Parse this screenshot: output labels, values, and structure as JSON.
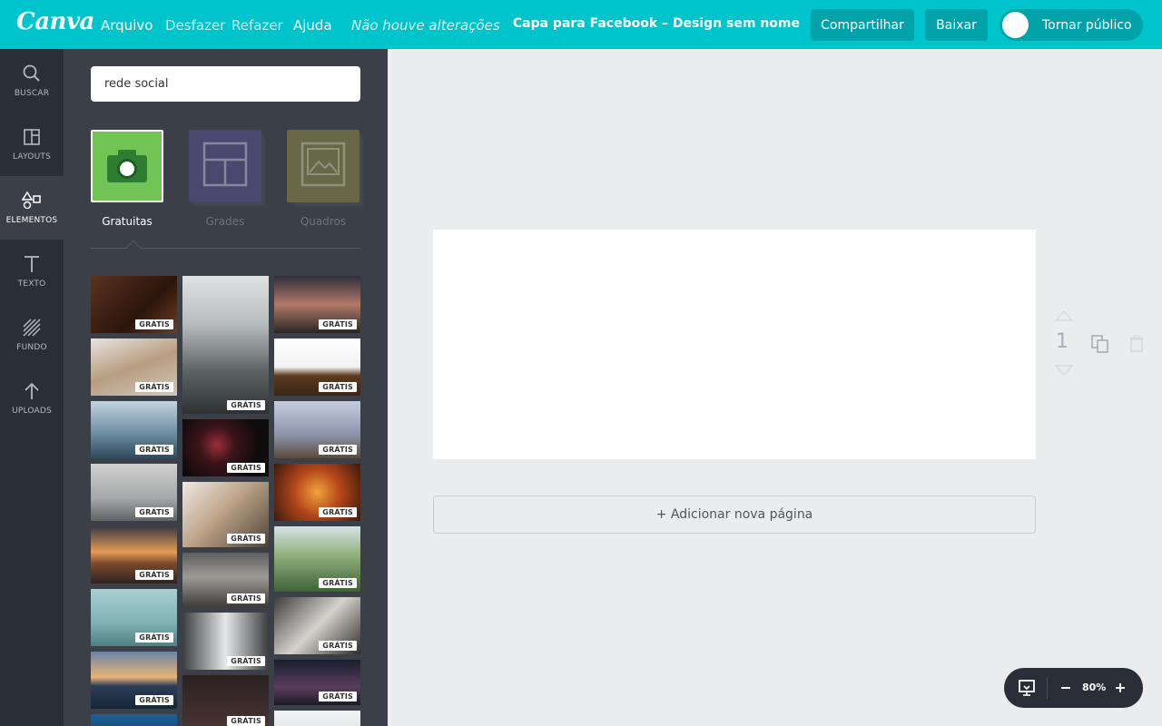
{
  "app": {
    "logo": "Canva"
  },
  "menu": {
    "file": "Arquivo",
    "undo": "Desfazer",
    "redo": "Refazer",
    "help": "Ajuda",
    "status": "Não houve alterações"
  },
  "header": {
    "doc_title": "Capa para Facebook – Design sem nome",
    "share": "Compartilhar",
    "download": "Baixar",
    "make_public": "Tornar público"
  },
  "sidebar": {
    "items": [
      {
        "label": "BUSCAR",
        "icon": "search-icon"
      },
      {
        "label": "LAYOUTS",
        "icon": "layouts-icon"
      },
      {
        "label": "ELEMENTOS",
        "icon": "elements-icon"
      },
      {
        "label": "TEXTO",
        "icon": "text-icon"
      },
      {
        "label": "FUNDO",
        "icon": "background-icon"
      },
      {
        "label": "UPLOADS",
        "icon": "upload-icon"
      }
    ],
    "active": "ELEMENTOS"
  },
  "panel": {
    "search_value": "rede social",
    "categories": [
      {
        "label": "Gratuitas",
        "icon": "camera-icon",
        "color": "#72c455"
      },
      {
        "label": "Grades",
        "icon": "grid-icon",
        "color": "#5b4f8f"
      },
      {
        "label": "Quadros",
        "icon": "frame-icon",
        "color": "#8e8b4a"
      }
    ],
    "badge": "GRÁTIS"
  },
  "editor": {
    "page_number": "1",
    "add_page": "+ Adicionar nova página",
    "zoom": "80%"
  }
}
